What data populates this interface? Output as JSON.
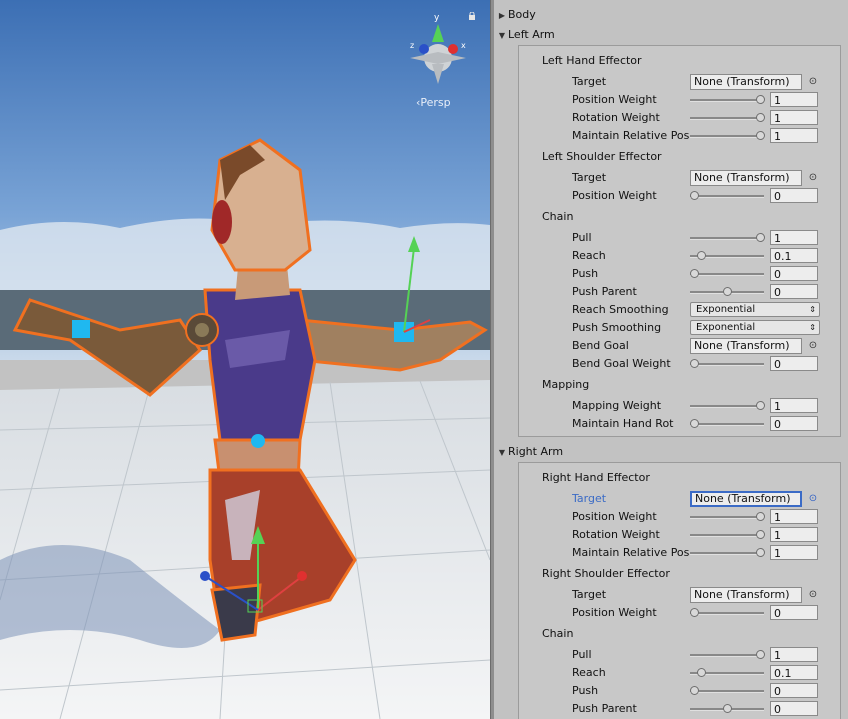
{
  "scene": {
    "persp_label": "‹Persp",
    "gizmo_axes": [
      "y",
      "z",
      "x"
    ]
  },
  "inspector": {
    "sections": {
      "body": "Body",
      "left_arm": "Left Arm",
      "right_arm": "Right Arm"
    },
    "left": {
      "hand_effector": "Left Hand Effector",
      "shoulder_effector": "Left Shoulder Effector",
      "chain": "Chain",
      "mapping": "Mapping",
      "props": [
        {
          "label": "Target",
          "kind": "object",
          "value": "None (Transform)"
        },
        {
          "label": "Position Weight",
          "kind": "slider",
          "value": "1",
          "fraction": 1
        },
        {
          "label": "Rotation Weight",
          "kind": "slider",
          "value": "1",
          "fraction": 1
        },
        {
          "label": "Maintain Relative Pos",
          "kind": "slider",
          "value": "1",
          "fraction": 1
        },
        {
          "label": "Target",
          "kind": "object",
          "value": "None (Transform)"
        },
        {
          "label": "Position Weight",
          "kind": "slider",
          "value": "0",
          "fraction": 0
        },
        {
          "label": "Pull",
          "kind": "slider",
          "value": "1",
          "fraction": 1
        },
        {
          "label": "Reach",
          "kind": "slider",
          "value": "0.1",
          "fraction": 0.1
        },
        {
          "label": "Push",
          "kind": "slider",
          "value": "0",
          "fraction": 0
        },
        {
          "label": "Push Parent",
          "kind": "slider",
          "value": "0",
          "fraction": 0.5
        },
        {
          "label": "Reach Smoothing",
          "kind": "popup",
          "value": "Exponential"
        },
        {
          "label": "Push Smoothing",
          "kind": "popup",
          "value": "Exponential"
        },
        {
          "label": "Bend Goal",
          "kind": "object",
          "value": "None (Transform)"
        },
        {
          "label": "Bend Goal Weight",
          "kind": "slider",
          "value": "0",
          "fraction": 0
        },
        {
          "label": "Mapping Weight",
          "kind": "slider",
          "value": "1",
          "fraction": 1
        },
        {
          "label": "Maintain Hand Rot",
          "kind": "slider",
          "value": "0",
          "fraction": 0
        }
      ]
    },
    "right": {
      "hand_effector": "Right Hand Effector",
      "shoulder_effector": "Right Shoulder Effector",
      "chain": "Chain",
      "props": [
        {
          "label": "Target",
          "kind": "object",
          "value": "None (Transform)",
          "focused": true
        },
        {
          "label": "Position Weight",
          "kind": "slider",
          "value": "1",
          "fraction": 1
        },
        {
          "label": "Rotation Weight",
          "kind": "slider",
          "value": "1",
          "fraction": 1
        },
        {
          "label": "Maintain Relative Pos",
          "kind": "slider",
          "value": "1",
          "fraction": 1
        },
        {
          "label": "Target",
          "kind": "object",
          "value": "None (Transform)"
        },
        {
          "label": "Position Weight",
          "kind": "slider",
          "value": "0",
          "fraction": 0
        },
        {
          "label": "Pull",
          "kind": "slider",
          "value": "1",
          "fraction": 1
        },
        {
          "label": "Reach",
          "kind": "slider",
          "value": "0.1",
          "fraction": 0.1
        },
        {
          "label": "Push",
          "kind": "slider",
          "value": "0",
          "fraction": 0
        },
        {
          "label": "Push Parent",
          "kind": "slider",
          "value": "0",
          "fraction": 0.5
        }
      ]
    }
  },
  "colors": {
    "focus_blue": "#3b6bc6",
    "selection_outline": "#f07020",
    "effector_cyan": "#1fb8f0"
  }
}
